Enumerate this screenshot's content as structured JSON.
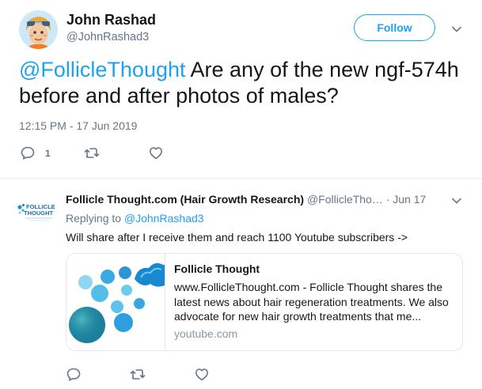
{
  "tweet": {
    "author": {
      "name": "John Rashad",
      "handle": "@JohnRashad3"
    },
    "follow_label": "Follow",
    "mention": "@FollicleThought",
    "text": " Are any of the new ngf-574h before and after photos of males?",
    "timestamp": "12:15 PM - 17 Jun 2019",
    "actions": {
      "reply_count": "1"
    }
  },
  "reply": {
    "author": {
      "name": "Follicle Thought.com (Hair Growth Research)",
      "handle": "@FollicleTho…",
      "logo_text": "FOLLICLE THOUGHT"
    },
    "date": "Jun 17",
    "replying_to_prefix": "Replying to ",
    "replying_to_handle": "@JohnRashad3",
    "text": "Will share after I receive them and reach 1100 Youtube subscribers ->",
    "card": {
      "title": "Follicle Thought",
      "description": "www.FollicleThought.com - Follicle Thought shares the latest news about hair regeneration treatments. We also advocate for new hair growth treatments that me...",
      "domain": "youtube.com"
    }
  },
  "colors": {
    "accent": "#1da1f2",
    "secondary_text": "#657786",
    "divider": "#e6ecf0"
  },
  "icons": [
    "avatar",
    "follow-button",
    "chevron-down-icon",
    "reply-icon",
    "retweet-icon",
    "like-icon",
    "follicle-thought-logo"
  ]
}
